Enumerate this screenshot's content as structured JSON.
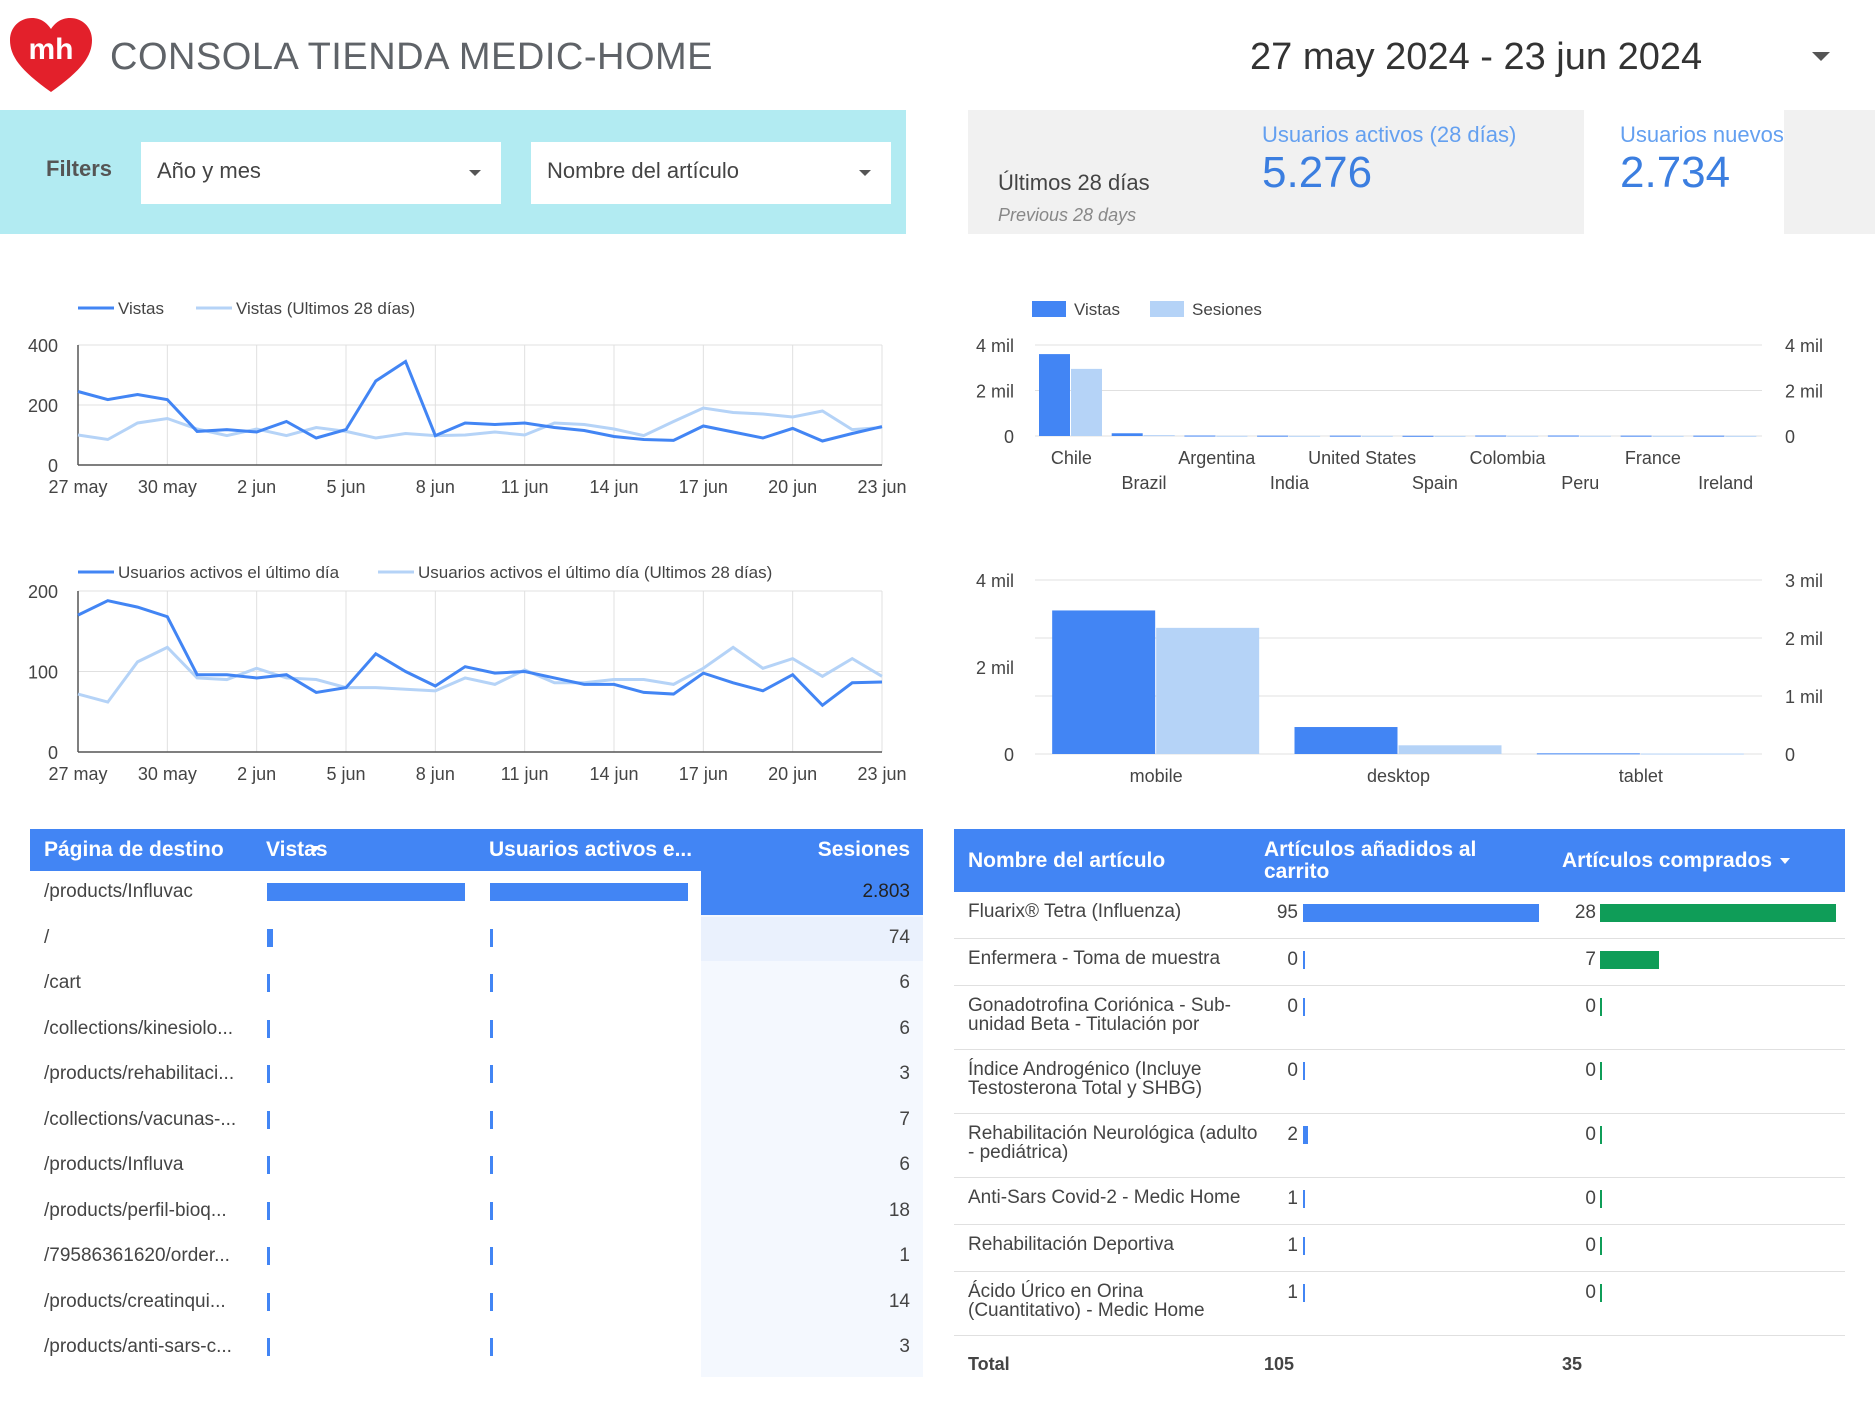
{
  "header": {
    "title": "CONSOLA TIENDA MEDIC-HOME",
    "logo_text": "mh",
    "date_range": "27 may 2024 - 23 jun 2024"
  },
  "filters": {
    "label": "Filters",
    "year_month": "Año y mes",
    "item_name": "Nombre del artículo"
  },
  "scorecard": {
    "period_label": "Últimos 28 días",
    "compare_label": "Previous 28 days",
    "active_users_label": "Usuarios activos (28 días)",
    "active_users_value": "5.276",
    "new_users_label": "Usuarios nuevos",
    "new_users_value": "2.734"
  },
  "colors": {
    "primary": "#4285f4",
    "light": "#b5d3f7",
    "green": "#0f9d58",
    "filters_bg": "#b2ebf2"
  },
  "chart_data": [
    {
      "type": "line",
      "legend": [
        "Vistas",
        "Vistas (Ultimos 28 días)"
      ],
      "x_ticks": [
        "27 may",
        "30 may",
        "2 jun",
        "5 jun",
        "8 jun",
        "11 jun",
        "14 jun",
        "17 jun",
        "20 jun",
        "23 jun"
      ],
      "y_ticks": [
        "0",
        "200",
        "400"
      ],
      "ylim": [
        0,
        400
      ],
      "series": [
        {
          "name": "Vistas",
          "values": [
            245,
            218,
            235,
            218,
            112,
            118,
            110,
            145,
            90,
            118,
            280,
            345,
            98,
            140,
            135,
            140,
            125,
            115,
            95,
            85,
            82,
            130,
            110,
            90,
            122,
            80,
            105,
            128
          ]
        },
        {
          "name": "Vistas (Ultimos 28 días)",
          "values": [
            100,
            85,
            140,
            155,
            120,
            98,
            120,
            98,
            125,
            112,
            90,
            105,
            98,
            100,
            110,
            100,
            140,
            135,
            120,
            98,
            145,
            190,
            175,
            170,
            160,
            180,
            118,
            125
          ]
        }
      ]
    },
    {
      "type": "line",
      "legend": [
        "Usuarios activos el último día",
        "Usuarios activos el último día (Ultimos 28 días)"
      ],
      "x_ticks": [
        "27 may",
        "30 may",
        "2 jun",
        "5 jun",
        "8 jun",
        "11 jun",
        "14 jun",
        "17 jun",
        "20 jun",
        "23 jun"
      ],
      "y_ticks": [
        "0",
        "100",
        "200"
      ],
      "ylim": [
        0,
        200
      ],
      "series": [
        {
          "name": "Usuarios activos el último día",
          "values": [
            170,
            188,
            180,
            168,
            96,
            96,
            92,
            96,
            74,
            80,
            122,
            100,
            82,
            106,
            98,
            100,
            92,
            84,
            84,
            74,
            72,
            98,
            86,
            76,
            96,
            58,
            86,
            87
          ]
        },
        {
          "name": "Usuarios activos el último día (Ultimos 28 días)",
          "values": [
            72,
            62,
            112,
            130,
            92,
            90,
            104,
            92,
            90,
            80,
            80,
            78,
            76,
            92,
            84,
            102,
            86,
            86,
            90,
            90,
            84,
            104,
            130,
            104,
            116,
            94,
            116,
            94,
            90
          ]
        }
      ]
    },
    {
      "type": "bar",
      "legend": [
        "Vistas",
        "Sesiones"
      ],
      "categories": [
        "Chile",
        "Brazil",
        "Argentina",
        "India",
        "United States",
        "Spain",
        "Colombia",
        "Peru",
        "France",
        "Ireland"
      ],
      "y_ticks": [
        "0",
        "2 mil",
        "4 mil"
      ],
      "ylim": [
        0,
        4000
      ],
      "series": [
        {
          "name": "Vistas",
          "values": [
            3600,
            120,
            20,
            15,
            15,
            10,
            20,
            20,
            15,
            15
          ]
        },
        {
          "name": "Sesiones",
          "values": [
            2950,
            40,
            10,
            8,
            8,
            6,
            10,
            10,
            8,
            8
          ]
        }
      ]
    },
    {
      "type": "bar",
      "categories": [
        "mobile",
        "desktop",
        "tablet"
      ],
      "y_ticks_left": [
        "0",
        "2 mil",
        "4 mil"
      ],
      "y_ticks_right": [
        "0",
        "1 mil",
        "2 mil",
        "3 mil"
      ],
      "ylim_left": [
        0,
        4000
      ],
      "ylim_right": [
        0,
        3000
      ],
      "series": [
        {
          "values": [
            3300,
            620,
            15
          ]
        },
        {
          "values": [
            2900,
            200,
            10
          ]
        }
      ]
    }
  ],
  "landing_table": {
    "headers": [
      "Página de destino",
      "Vistas",
      "Usuarios activos e...",
      "Sesiones"
    ],
    "rows": [
      {
        "page": "/products/Influvac",
        "views": 2800,
        "users": 2300,
        "sessions": "2.803"
      },
      {
        "page": "/",
        "views": 80,
        "users": 25,
        "sessions": "74"
      },
      {
        "page": "/cart",
        "views": 25,
        "users": 6,
        "sessions": "6"
      },
      {
        "page": "/collections/kinesiolo...",
        "views": 6,
        "users": 5,
        "sessions": "6"
      },
      {
        "page": "/products/rehabilitaci...",
        "views": 5,
        "users": 4,
        "sessions": "3"
      },
      {
        "page": "/collections/vacunas-...",
        "views": 6,
        "users": 5,
        "sessions": "7"
      },
      {
        "page": "/products/Influva",
        "views": 6,
        "users": 5,
        "sessions": "6"
      },
      {
        "page": "/products/perfil-bioq...",
        "views": 6,
        "users": 5,
        "sessions": "18"
      },
      {
        "page": "/79586361620/order...",
        "views": 5,
        "users": 4,
        "sessions": "1"
      },
      {
        "page": "/products/creatinqui...",
        "views": 5,
        "users": 4,
        "sessions": "14"
      },
      {
        "page": "/products/anti-sars-c...",
        "views": 5,
        "users": 4,
        "sessions": "3"
      }
    ]
  },
  "items_table": {
    "headers": [
      "Nombre del artículo",
      "Artículos añadidos al carrito",
      "Artículos comprados"
    ],
    "rows": [
      {
        "name": "Fluarix® Tetra (Influenza)",
        "added": "95",
        "added_n": 95,
        "bought": "28",
        "bought_n": 28
      },
      {
        "name": "Enfermera - Toma de muestra",
        "added": "0",
        "added_n": 0,
        "bought": "7",
        "bought_n": 7
      },
      {
        "name": "Gonadotrofina Coriónica - Sub-unidad Beta - Titulación por",
        "added": "0",
        "added_n": 0,
        "bought": "0",
        "bought_n": 0
      },
      {
        "name": "Índice Androgénico (Incluye Testosterona Total y SHBG)",
        "added": "0",
        "added_n": 0,
        "bought": "0",
        "bought_n": 0
      },
      {
        "name": "Rehabilitación Neurológica (adulto - pediátrica)",
        "added": "2",
        "added_n": 2,
        "bought": "0",
        "bought_n": 0
      },
      {
        "name": "Anti-Sars Covid-2 - Medic Home",
        "added": "1",
        "added_n": 1,
        "bought": "0",
        "bought_n": 0
      },
      {
        "name": "Rehabilitación Deportiva",
        "added": "1",
        "added_n": 1,
        "bought": "0",
        "bought_n": 0
      },
      {
        "name": "Ácido Úrico en Orina (Cuantitativo) - Medic Home",
        "added": "1",
        "added_n": 1,
        "bought": "0",
        "bought_n": 0
      }
    ],
    "total_label": "Total",
    "total_added": "105",
    "total_bought": "35"
  }
}
